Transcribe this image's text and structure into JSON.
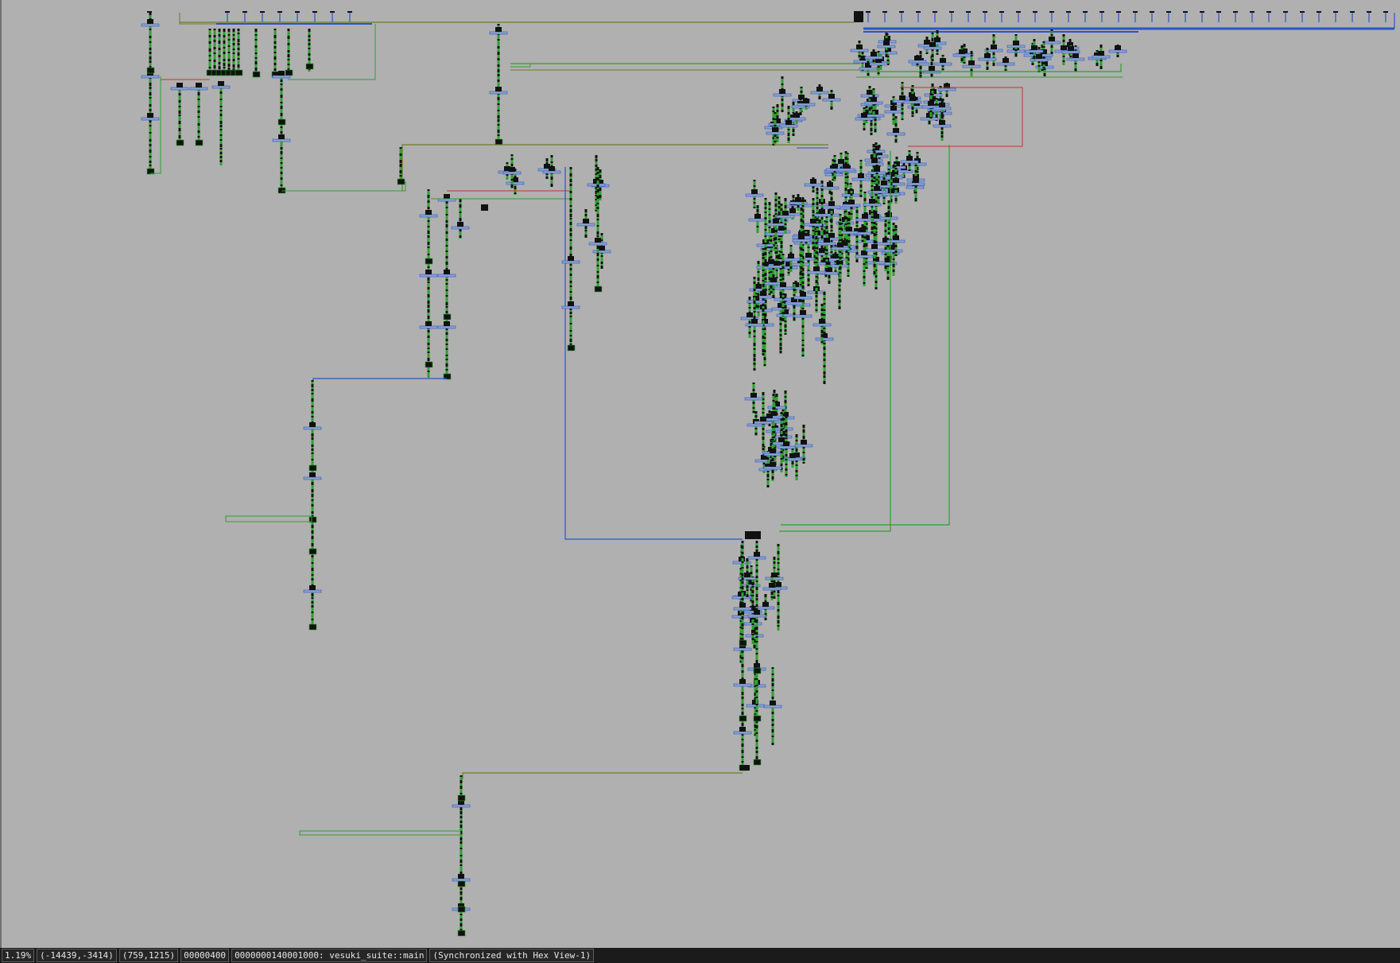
{
  "window": {
    "canvas_background": "#b0b0b0"
  },
  "status_bar": {
    "zoom": "1.19%",
    "view_offset": "(-14439,-3414)",
    "cursor_pos": "(759,1215)",
    "cursor_address": "00000400",
    "current_function": "0000000140001000: vesuki_suite::main",
    "sync_status": "(Synchronized with Hex View-1)"
  },
  "graph": {
    "description_icon": "control-flow-graph-icon",
    "colors": {
      "block_edge_green": "#2ea02e",
      "block_fill_dark": "#111111",
      "true_edge": "#2f8f2f",
      "false_edge": "#c0392b",
      "unconditional_edge": "#2a55c8",
      "back_edge": "#6b7c2a"
    }
  }
}
